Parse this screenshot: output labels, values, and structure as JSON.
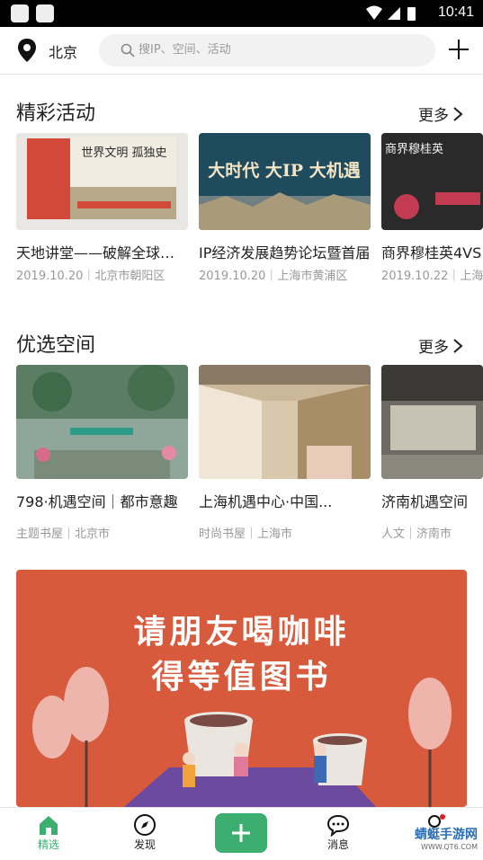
{
  "status_bar": {
    "time": "10:41"
  },
  "header": {
    "city": "北京",
    "search_placeholder": "搜IP、空间、活动"
  },
  "activities": {
    "title": "精彩活动",
    "more": "更多",
    "cards": [
      {
        "title": "天地讲堂——破解全球发展之谜",
        "meta": "2019.10.20｜北京市朝阳区",
        "image_text": "世界文明 孤独史"
      },
      {
        "title": "IP经济发展趋势论坛暨首届",
        "meta": "2019.10.20｜上海市黄浦区",
        "image_text": "大时代 大IP 大机遇"
      },
      {
        "title": "商界穆桂英4VS",
        "meta": "2019.10.22｜上海",
        "image_text": "商界穆桂英"
      }
    ]
  },
  "spaces": {
    "title": "优选空间",
    "more": "更多",
    "cards": [
      {
        "title": "798·机遇空间｜都市意趣",
        "meta": "主题书屋｜北京市"
      },
      {
        "title": "上海机遇中心·中国...",
        "meta": "时尚书屋｜上海市"
      },
      {
        "title": "济南机遇空间",
        "meta": "人文｜济南市"
      }
    ]
  },
  "banner": {
    "line1": "请朋友喝咖啡",
    "line2": "得等值图书"
  },
  "tabs": [
    {
      "label": "精选",
      "icon": "home-icon",
      "active": true
    },
    {
      "label": "发现",
      "icon": "compass-icon"
    },
    {
      "label": "",
      "icon": "plus-icon"
    },
    {
      "label": "消息",
      "icon": "message-icon"
    },
    {
      "label": "",
      "icon": "profile-icon"
    }
  ],
  "watermark": {
    "text": "蜻蜓手游网",
    "url": "WWW.QT6.COM"
  },
  "colors": {
    "accent": "#3cae6f",
    "banner": "#d85a3d"
  }
}
